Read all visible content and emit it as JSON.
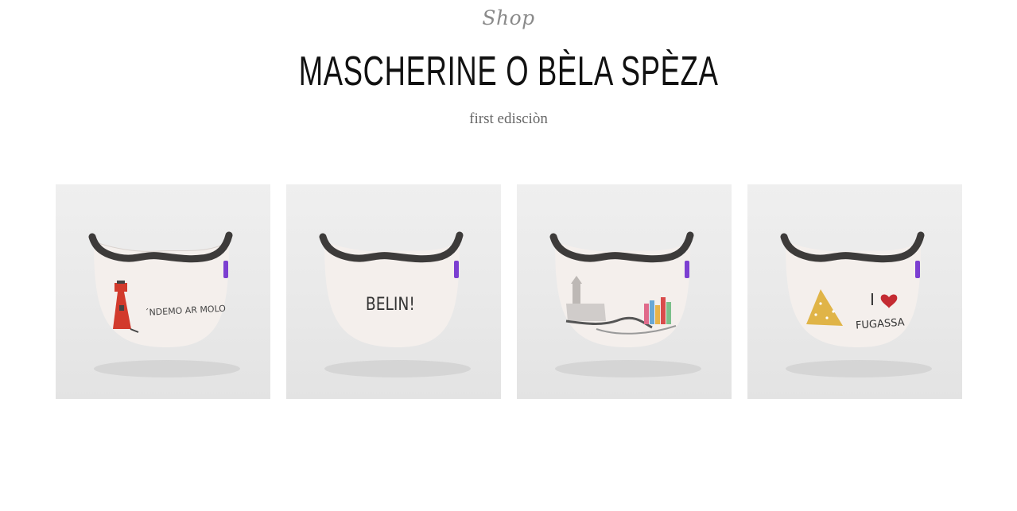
{
  "header": {
    "eyebrow": "Shop",
    "title": "MASCHERINE O BÈLA SPÈZA",
    "subtitle": "first edisciòn"
  },
  "products": [
    {
      "design": "lighthouse",
      "print_text": "´NDEMO AR MOLO",
      "colors": {
        "ink": "#444444",
        "accent": "#d23a2c"
      }
    },
    {
      "design": "text",
      "print_text": "BELIN!",
      "colors": {
        "ink": "#333333"
      }
    },
    {
      "design": "harbour",
      "print_text": "",
      "colors": {
        "ink": "#8e8e8e"
      }
    },
    {
      "design": "focaccia",
      "print_text_top": "I",
      "print_text_bottom": "FUGASSA",
      "colors": {
        "ink": "#333333",
        "accent": "#c42b32",
        "focaccia": "#e0b447"
      }
    }
  ],
  "colors": {
    "strap": "#3d3b3a",
    "mask": "#f4f0ee",
    "tag": "#7c3fd1"
  }
}
